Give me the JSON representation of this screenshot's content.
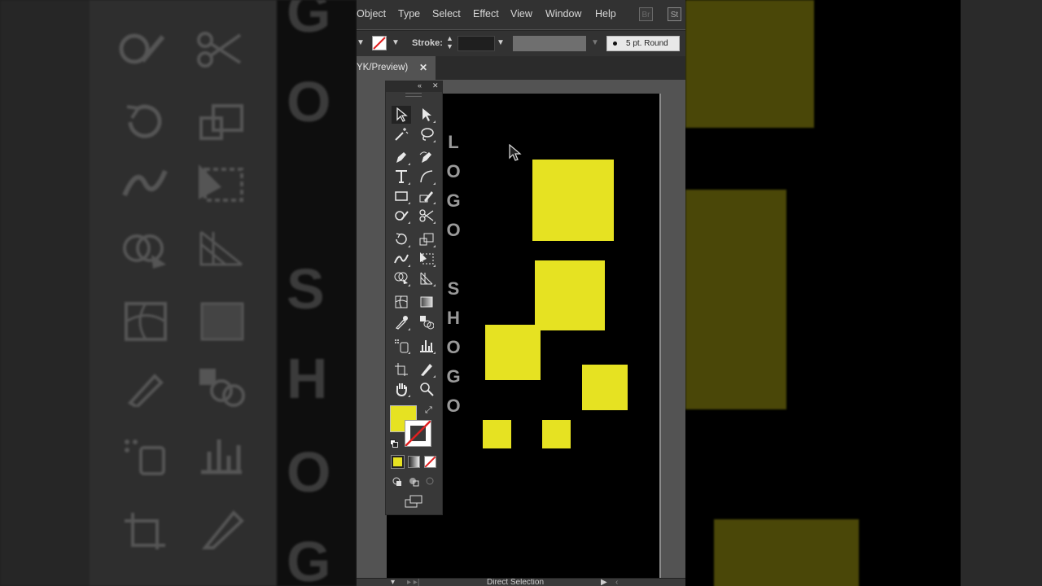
{
  "menu": {
    "items": [
      "Object",
      "Type",
      "Select",
      "Effect",
      "View",
      "Window",
      "Help"
    ],
    "app_icons": [
      "Br",
      "St"
    ]
  },
  "control_bar": {
    "stroke_label": "Stroke:",
    "brush_profile": "5 pt. Round"
  },
  "document_tab": {
    "title": "YK/Preview)",
    "close": "✕"
  },
  "toolbar": {
    "tools": [
      "selection-tool",
      "direct-selection-tool",
      "magic-wand-tool",
      "lasso-tool",
      "pen-tool",
      "curvature-pen-tool",
      "type-tool",
      "arc-tool",
      "rectangle-tool",
      "pencil-tool",
      "shaper-tool",
      "scissors-tool",
      "rotate-tool",
      "scale-tool",
      "warp-tool",
      "free-transform-tool",
      "shape-builder-tool",
      "perspective-grid-tool",
      "mesh-tool",
      "gradient-tool",
      "eyedropper-tool",
      "blend-tool",
      "symbol-sprayer-tool",
      "column-graph-tool",
      "artboard-tool",
      "slice-tool",
      "hand-tool",
      "zoom-tool"
    ],
    "fill_color": "#E6E222",
    "stroke_color": "none"
  },
  "artboard": {
    "text_column_1": [
      "L",
      "O",
      "G",
      "O"
    ],
    "text_column_2": [
      "S",
      "H",
      "O",
      "G",
      "O"
    ],
    "shape_color": "#E6E222"
  },
  "status_bar": {
    "tool_name": "Direct Selection"
  },
  "background": {
    "letters": [
      "G",
      "O",
      "S",
      "H",
      "O",
      "G"
    ]
  }
}
